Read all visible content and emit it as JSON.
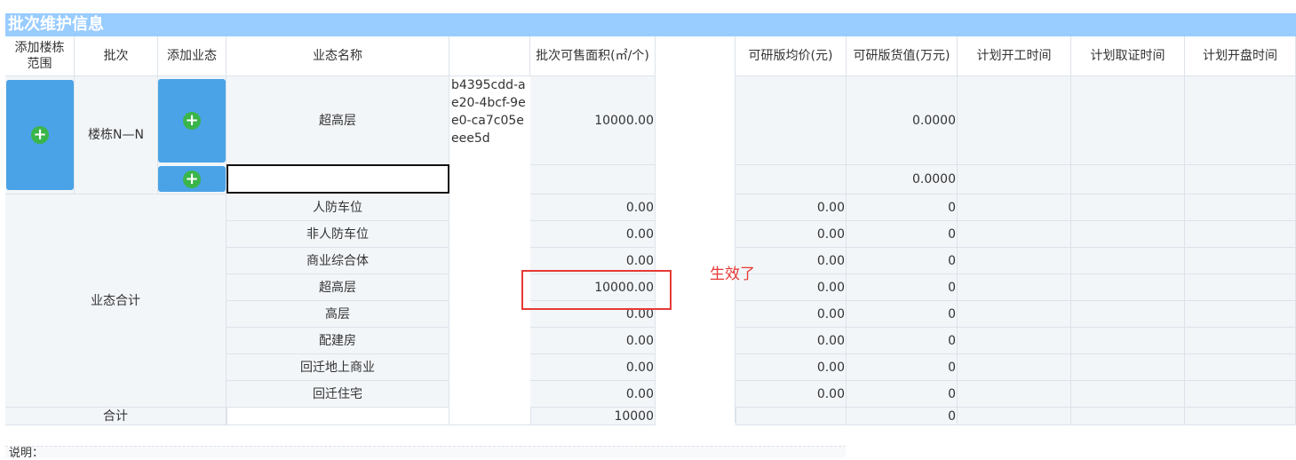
{
  "panel": {
    "title": "批次维护信息"
  },
  "columns": {
    "add_building": "添加楼栋\n范围",
    "batch": "批次",
    "add_format": "添加业态",
    "format_name": "业态名称",
    "sale_area": "批次可售面积(㎡/个)",
    "avg_price": "可研版均价(元)",
    "value": "可研版货值(万元)",
    "start_time": "计划开工时间",
    "permit_time": "计划取证时间",
    "open_time": "计划开盘时间"
  },
  "batch_row": {
    "building": "楼栋N—N",
    "format": "超高层",
    "uuid": "b4395cdd-ae20-4bcf-9ee0-ca7c05eeee5d",
    "area": "10000.00",
    "value": "0.0000",
    "row2_value": "0.0000",
    "new_format_input": ""
  },
  "summary": {
    "label": "业态合计",
    "rows": [
      {
        "name": "人防车位",
        "area": "0.00",
        "price": "0.00",
        "value": "0"
      },
      {
        "name": "非人防车位",
        "area": "0.00",
        "price": "0.00",
        "value": "0"
      },
      {
        "name": "商业综合体",
        "area": "0.00",
        "price": "0.00",
        "value": "0"
      },
      {
        "name": "超高层",
        "area": "10000.00",
        "price": "0.00",
        "value": "0"
      },
      {
        "name": "高层",
        "area": "0.00",
        "price": "0.00",
        "value": "0"
      },
      {
        "name": "配建房",
        "area": "0.00",
        "price": "0.00",
        "value": "0"
      },
      {
        "name": "回迁地上商业",
        "area": "0.00",
        "price": "0.00",
        "value": "0"
      },
      {
        "name": "回迁住宅",
        "area": "0.00",
        "price": "0.00",
        "value": "0"
      }
    ]
  },
  "total": {
    "label": "合计",
    "area": "10000",
    "value": "0"
  },
  "annotation": {
    "text": "生效了",
    "color": "#e53935"
  },
  "footer": {
    "label": "说明："
  },
  "colors": {
    "header": "#99ccff",
    "button": "#4aa3e6",
    "plus": "#3ab54a"
  },
  "icons": {
    "add": "plus-circle-icon"
  }
}
